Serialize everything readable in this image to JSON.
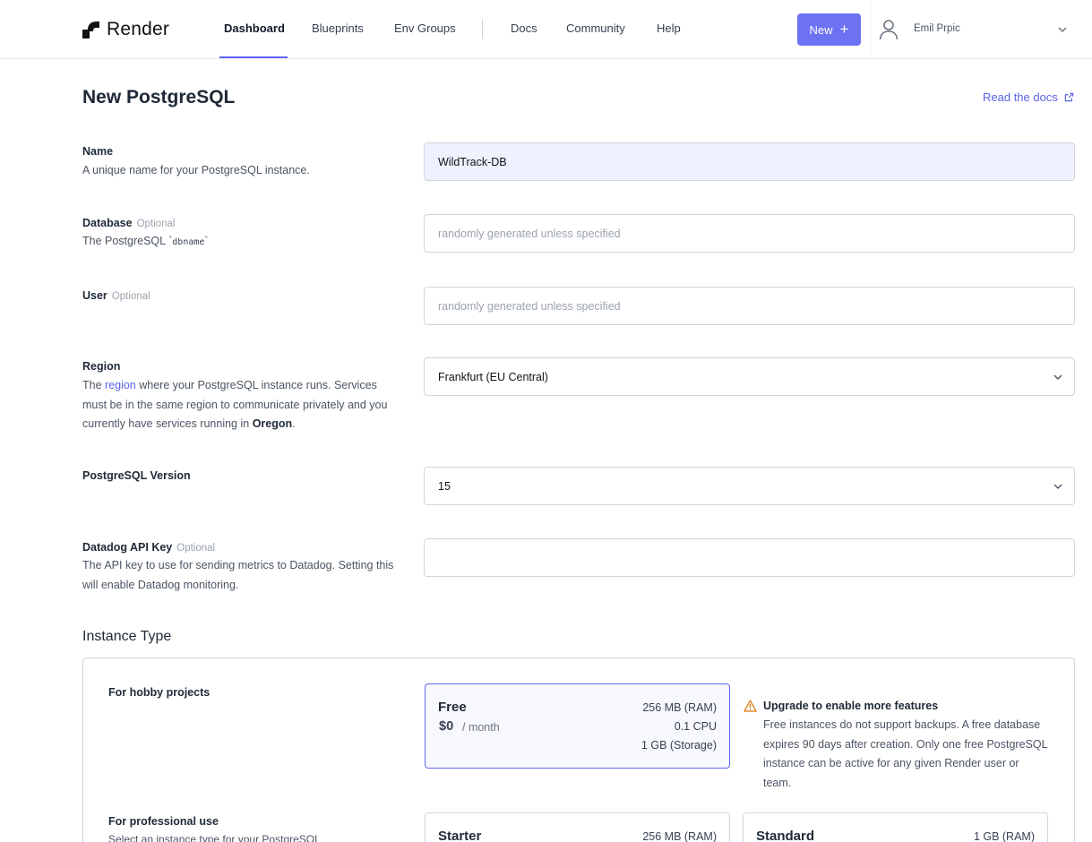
{
  "header": {
    "brand": "Render",
    "nav": [
      {
        "label": "Dashboard",
        "active": true
      },
      {
        "label": "Blueprints"
      },
      {
        "label": "Env Groups"
      },
      {
        "label": "Docs"
      },
      {
        "label": "Community"
      },
      {
        "label": "Help"
      }
    ],
    "new_button": "New",
    "new_icon": "plus-icon",
    "user_name": "Emil Prpic",
    "accent_color": "#6d72f3"
  },
  "page": {
    "title": "New PostgreSQL",
    "docs_link": "Read the docs"
  },
  "fields": {
    "name": {
      "label": "Name",
      "description": "A unique name for your PostgreSQL instance.",
      "value": "WildTrack-DB"
    },
    "database": {
      "label": "Database",
      "optional": "Optional",
      "description_prefix": "The PostgreSQL `",
      "description_code": "dbname",
      "description_suffix": "`",
      "placeholder": "randomly generated unless specified"
    },
    "user": {
      "label": "User",
      "optional": "Optional",
      "placeholder": "randomly generated unless specified"
    },
    "region": {
      "label": "Region",
      "desc_1": "The ",
      "desc_link": "region",
      "desc_2": " where your PostgreSQL instance runs. Services must be in the same region to communicate privately and you currently have services running in ",
      "desc_bold": "Oregon",
      "desc_3": ".",
      "value": "Frankfurt (EU Central)"
    },
    "version": {
      "label": "PostgreSQL Version",
      "value": "15"
    },
    "datadog": {
      "label": "Datadog API Key",
      "optional": "Optional",
      "description": "The API key to use for sending metrics to Datadog. Setting this will enable Datadog monitoring.",
      "value": ""
    }
  },
  "instance_type": {
    "title": "Instance Type",
    "hobby_label": "For hobby projects",
    "pro_label": "For professional use",
    "pro_desc": "Select an instance type for your PostgreSQL",
    "free": {
      "name": "Free",
      "price": "$0",
      "per": "/ month",
      "ram": "256 MB (RAM)",
      "cpu": "0.1 CPU",
      "storage": "1 GB (Storage)"
    },
    "starter": {
      "name": "Starter",
      "ram": "256 MB (RAM)"
    },
    "standard": {
      "name": "Standard",
      "ram": "1 GB (RAM)"
    },
    "notice": {
      "icon": "warning-icon",
      "title": "Upgrade to enable more features",
      "body": "Free instances do not support backups. A free database expires 90 days after creation. Only one free PostgreSQL instance can be active for any given Render user or team."
    }
  }
}
